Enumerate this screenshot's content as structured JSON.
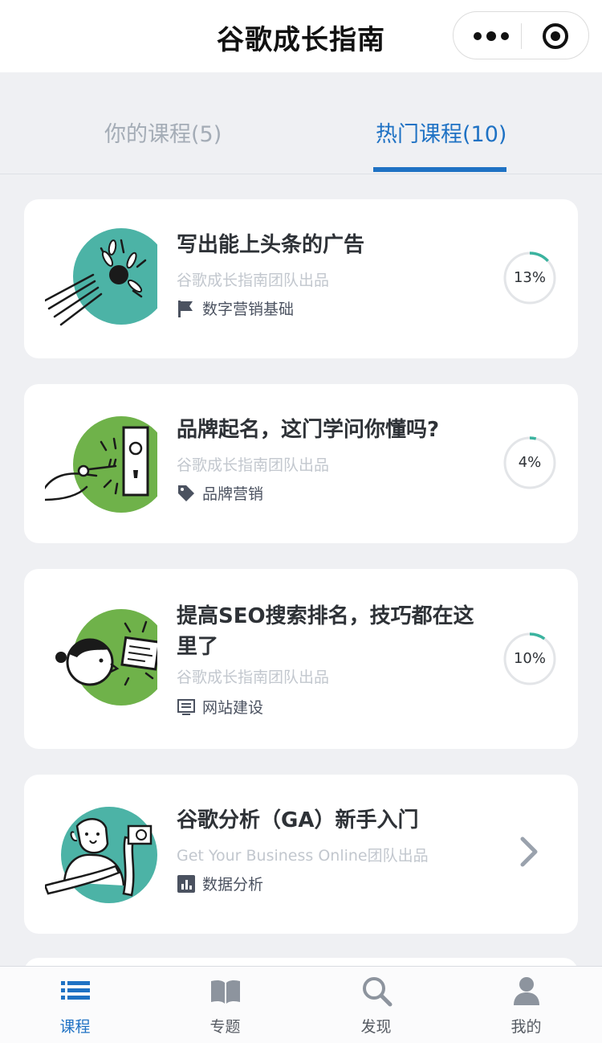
{
  "app_title": "谷歌成长指南",
  "tabs": [
    {
      "label": "你的课程(5)"
    },
    {
      "label": "热门课程(10)"
    }
  ],
  "courses": [
    {
      "title": "写出能上头条的广告",
      "author": "谷歌成长指南团队出品",
      "tag": "数字营销基础",
      "tag_icon": "flag-icon",
      "progress_text": "13%",
      "progress": 0.13,
      "thumb_color": "#4cb3a6"
    },
    {
      "title": "品牌起名，这门学问你懂吗?",
      "author": "谷歌成长指南团队出品",
      "tag": "品牌营销",
      "tag_icon": "tag-icon",
      "progress_text": "4%",
      "progress": 0.04,
      "thumb_color": "#6fb24a"
    },
    {
      "title_line1": "提高SEO搜索排名，技巧都在这",
      "title_line2": "里了",
      "author": "谷歌成长指南团队出品",
      "tag": "网站建设",
      "tag_icon": "monitor-icon",
      "progress_text": "10%",
      "progress": 0.1,
      "thumb_color": "#6fb24a"
    },
    {
      "title": "谷歌分析（GA）新手入门",
      "author": "Get Your Business Online团队出品",
      "tag": "数据分析",
      "tag_icon": "bar-chart-icon",
      "thumb_color": "#4cb3a6"
    }
  ],
  "bottom_nav": [
    {
      "label": "课程",
      "icon": "list-icon",
      "active": true
    },
    {
      "label": "专题",
      "icon": "book-icon",
      "active": false
    },
    {
      "label": "发现",
      "icon": "search-icon",
      "active": false
    },
    {
      "label": "我的",
      "icon": "person-icon",
      "active": false
    }
  ],
  "colors": {
    "accent": "#1f72c4",
    "progress_ring": "#3bb39f"
  }
}
